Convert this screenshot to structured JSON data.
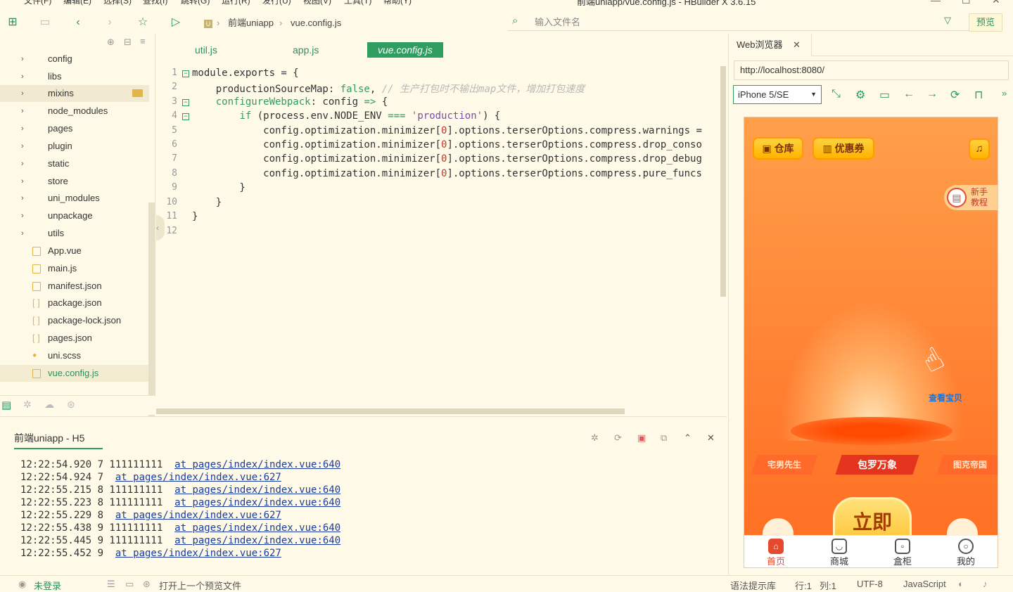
{
  "window": {
    "title": "前端uniapp/vue.config.js - HBuilder X 3.6.15",
    "menu": [
      "文件(F)",
      "编辑(E)",
      "选择(S)",
      "查找(I)",
      "跳转(G)",
      "运行(R)",
      "发行(U)",
      "视图(V)",
      "工具(T)",
      "帮助(Y)"
    ]
  },
  "toolbar": {
    "breadcrumb": [
      "前端uniapp",
      "vue.config.js"
    ],
    "file_search_placeholder": "输入文件名",
    "preview_label": "预览"
  },
  "sidebar": {
    "items": [
      {
        "label": "config",
        "type": "folder"
      },
      {
        "label": "libs",
        "type": "folder"
      },
      {
        "label": "mixins",
        "type": "folder"
      },
      {
        "label": "node_modules",
        "type": "folder"
      },
      {
        "label": "pages",
        "type": "folder"
      },
      {
        "label": "plugin",
        "type": "folder"
      },
      {
        "label": "static",
        "type": "folder"
      },
      {
        "label": "store",
        "type": "folder"
      },
      {
        "label": "uni_modules",
        "type": "folder"
      },
      {
        "label": "unpackage",
        "type": "folder"
      },
      {
        "label": "utils",
        "type": "folder"
      },
      {
        "label": "App.vue",
        "type": "file"
      },
      {
        "label": "main.js",
        "type": "file"
      },
      {
        "label": "manifest.json",
        "type": "file"
      },
      {
        "label": "package.json",
        "type": "file"
      },
      {
        "label": "package-lock.json",
        "type": "file"
      },
      {
        "label": "pages.json",
        "type": "file"
      },
      {
        "label": "uni.scss",
        "type": "file"
      },
      {
        "label": "vue.config.js",
        "type": "file"
      }
    ]
  },
  "editor": {
    "tabs": [
      "util.js",
      "app.js",
      "vue.config.js"
    ],
    "active_tab": "vue.config.js",
    "line_numbers": [
      "1",
      "2",
      "3",
      "4",
      "5",
      "6",
      "7",
      "8",
      "9",
      "10",
      "11",
      "12"
    ]
  },
  "console": {
    "tab_label": "前端uniapp - H5",
    "logs": [
      {
        "text": "12:22:54.920 7 111111111  ",
        "link": "at pages/index/index.vue:640"
      },
      {
        "text": "12:22:54.924 7  ",
        "link": "at pages/index/index.vue:627"
      },
      {
        "text": "12:22:55.215 8 111111111  ",
        "link": "at pages/index/index.vue:640"
      },
      {
        "text": "12:22:55.223 8 111111111  ",
        "link": "at pages/index/index.vue:640"
      },
      {
        "text": "12:22:55.229 8  ",
        "link": "at pages/index/index.vue:627"
      },
      {
        "text": "12:22:55.438 9 111111111  ",
        "link": "at pages/index/index.vue:640"
      },
      {
        "text": "12:22:55.445 9 111111111  ",
        "link": "at pages/index/index.vue:640"
      },
      {
        "text": "12:22:55.452 9  ",
        "link": "at pages/index/index.vue:627"
      }
    ]
  },
  "statusbar": {
    "login": "未登录",
    "hint": "打开上一个预览文件",
    "syntax": "语法提示库",
    "line": "行:1",
    "col": "列:1",
    "encoding": "UTF-8",
    "language": "JavaScript"
  },
  "browser": {
    "tab_label": "Web浏览器",
    "url": "http://localhost:8080/",
    "device": "iPhone 5/SE",
    "app": {
      "warehouse_label": "仓库",
      "coupon_label": "优惠券",
      "tutorial_label": "新手教程",
      "look_label": "查看宝贝",
      "categories": [
        "宅男先生",
        "包罗万象",
        "图克帝国"
      ],
      "big_button": "立即",
      "tabs": [
        "首页",
        "商城",
        "盒柜",
        "我的"
      ]
    }
  }
}
